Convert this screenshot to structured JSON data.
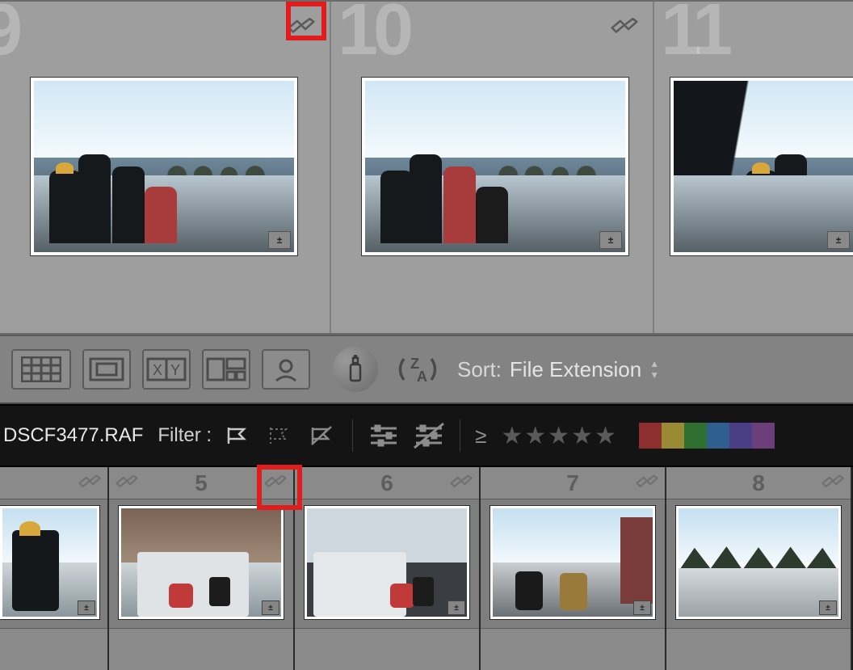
{
  "grid": {
    "cells": [
      {
        "index": "9"
      },
      {
        "index": "10"
      },
      {
        "index": "11"
      }
    ]
  },
  "toolbar": {
    "sort_label": "Sort:",
    "sort_value": "File Extension"
  },
  "filter": {
    "filename": "DSCF3477.RAF",
    "label": "Filter :",
    "geq": "≥",
    "star_count": 5,
    "colors": [
      "#b23b3b",
      "#c6a83a",
      "#3f8f3f",
      "#3a6fb0",
      "#5a4aa0",
      "#8f4aa0"
    ]
  },
  "filmstrip": {
    "cells": [
      {
        "num": ""
      },
      {
        "num": "5"
      },
      {
        "num": "6"
      },
      {
        "num": "7"
      },
      {
        "num": "8"
      }
    ]
  }
}
